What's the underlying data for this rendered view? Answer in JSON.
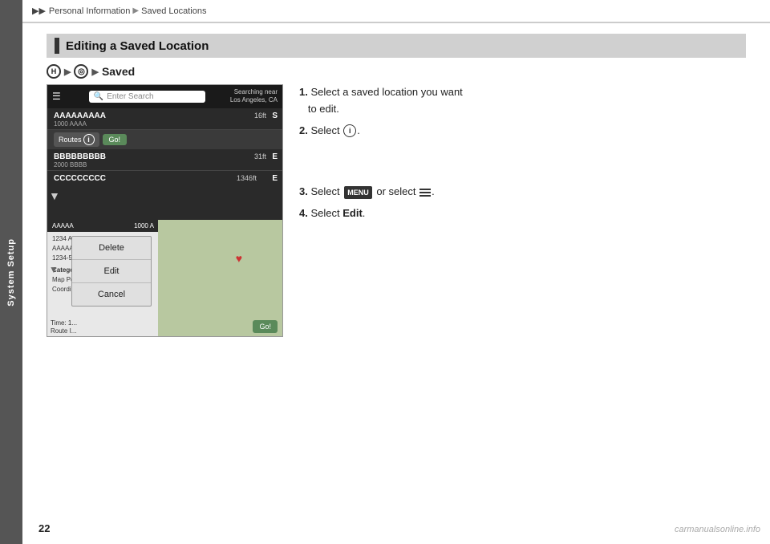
{
  "sidebar": {
    "label": "System Setup"
  },
  "breadcrumb": {
    "part1": "Personal Information",
    "part2": "Saved Locations",
    "arrow": "▶"
  },
  "page_number": "22",
  "watermark": "carmanualsonline.info",
  "section": {
    "heading": "Editing a Saved Location"
  },
  "nav_path": {
    "icon1": "H",
    "icon2": "◎",
    "label": "Saved"
  },
  "screenshot": {
    "search_placeholder": "Enter Search",
    "searching_near": "Searching near\nLos Angeles, CA",
    "item1_name": "AAAAAAAAA",
    "item1_sub": "1000 AAAA",
    "item1_dist": "16",
    "item1_unit": "ft",
    "item1_letter": "S",
    "route_label": "Routes",
    "go_label": "Go!",
    "item2_name": "BBBBBBBBB",
    "item2_sub": "2000 BBBB",
    "item2_dist": "31",
    "item2_unit": "ft",
    "item2_letter": "E",
    "item3_name": "CCCCCCCCC",
    "item3_dist": "1346",
    "item3_unit": "ft",
    "item3_letter": "E",
    "map_item_name": "AAAAA",
    "map_item_addr": "1000 A",
    "map_addr_detail": "1234 AAA\nAAAAA\n1234-567",
    "map_category": "Category",
    "map_sub1": "Map Point",
    "map_sub2": "Coordinate",
    "context_delete": "Delete",
    "context_edit": "Edit",
    "context_cancel": "Cancel",
    "map_go": "Go!"
  },
  "instructions": {
    "step1_num": "1.",
    "step1_text": "Select a saved location you want\nto edit.",
    "step2_num": "2.",
    "step2_text": "Select",
    "step3_num": "3.",
    "step3_text": "Select",
    "step3_mid": "or select",
    "step4_num": "4.",
    "step4_text": "Select",
    "step4_bold": "Edit",
    "menu_label": "MENU"
  }
}
